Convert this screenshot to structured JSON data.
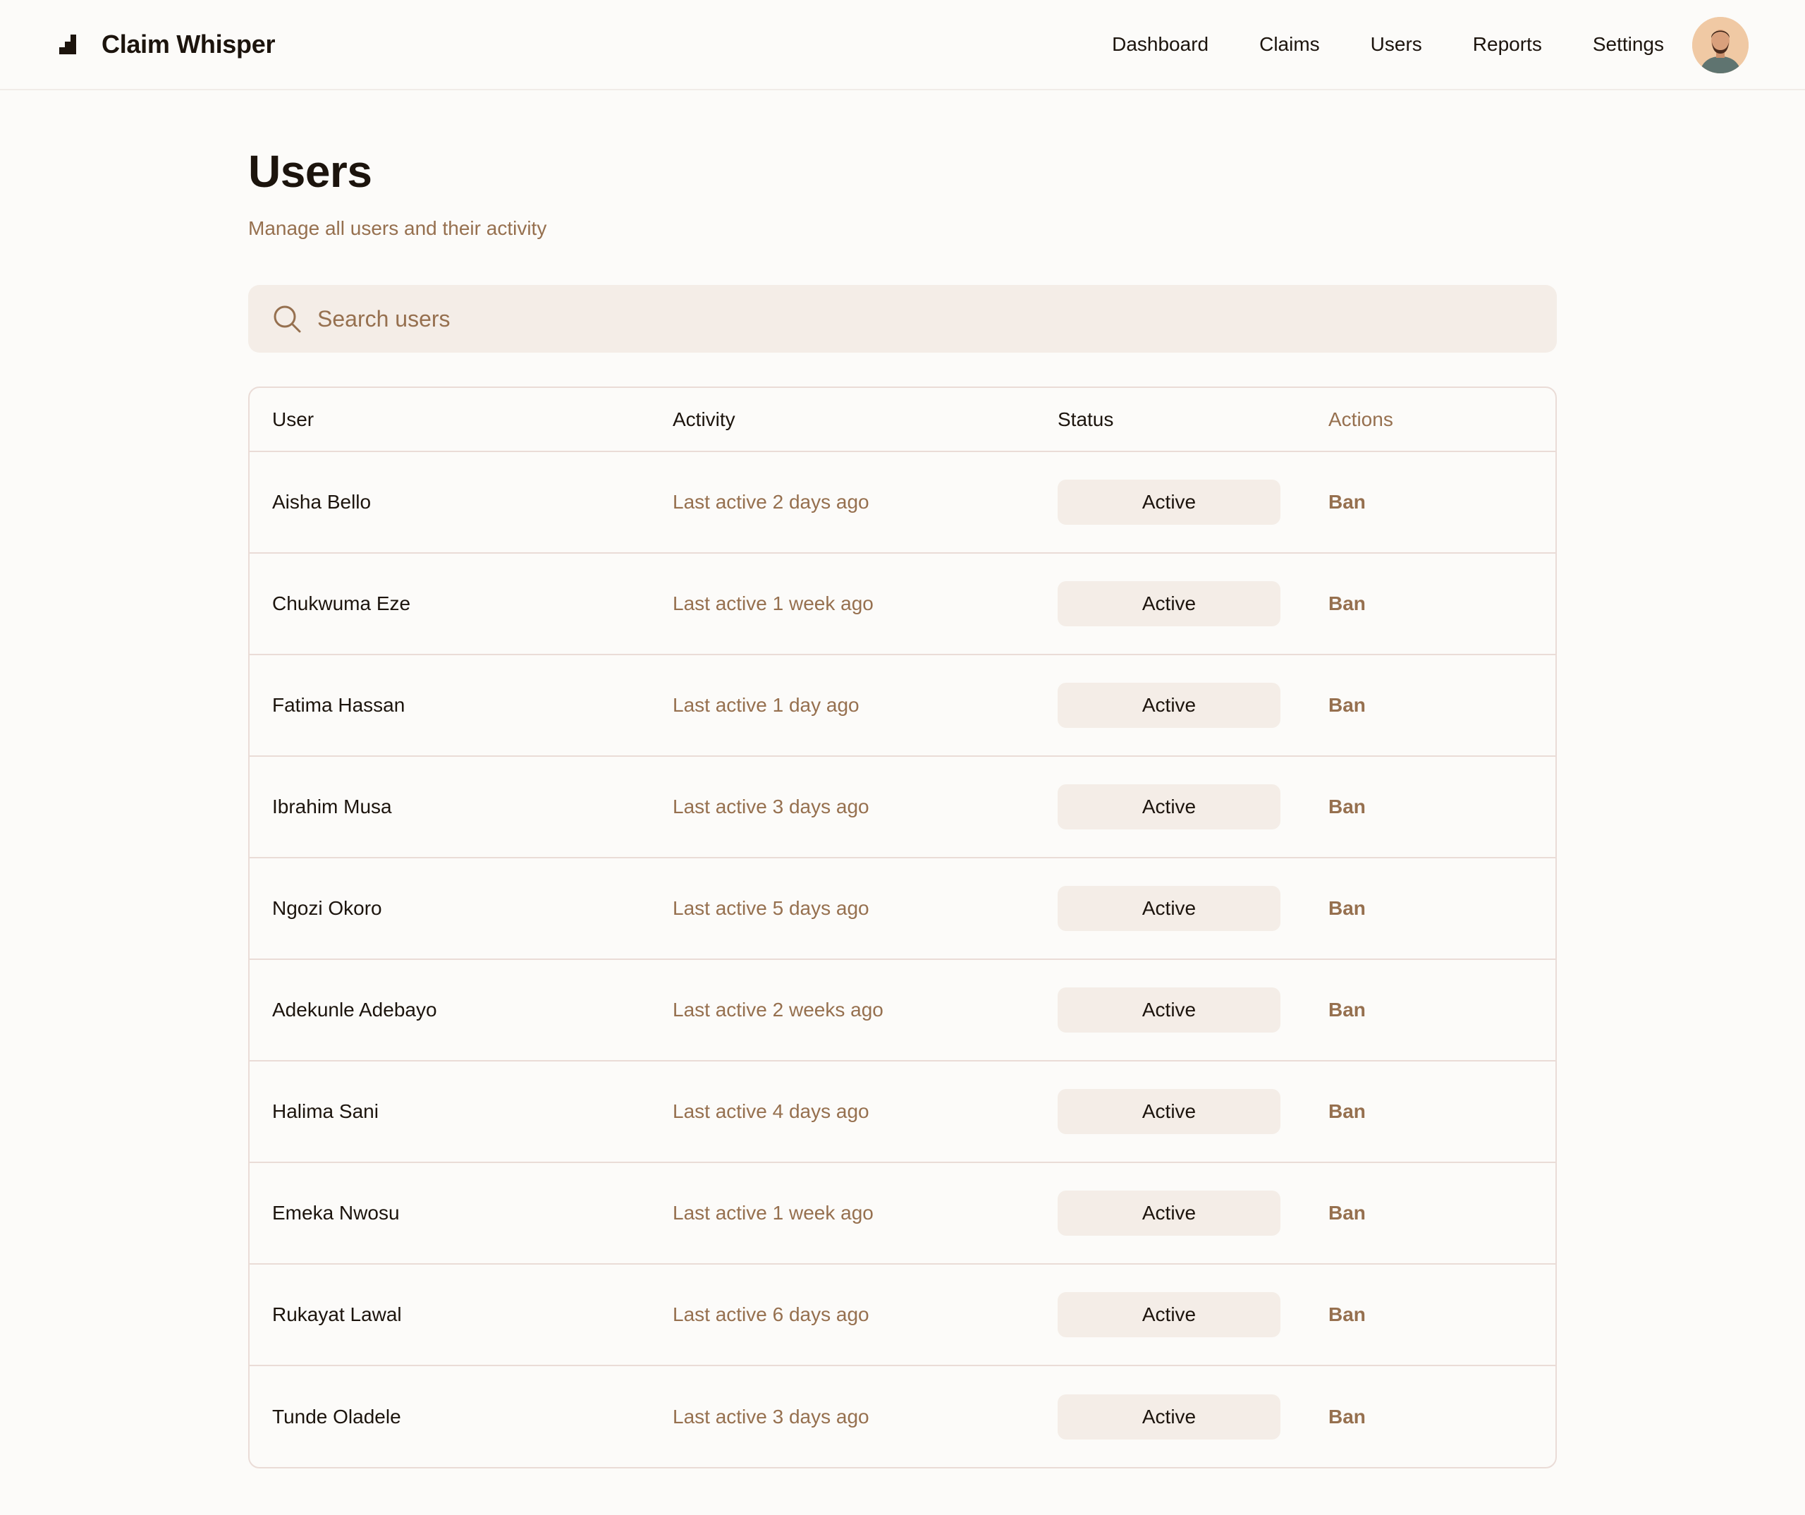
{
  "app": {
    "title": "Claim Whisper"
  },
  "nav": {
    "items": [
      {
        "label": "Dashboard"
      },
      {
        "label": "Claims"
      },
      {
        "label": "Users"
      },
      {
        "label": "Reports"
      },
      {
        "label": "Settings"
      }
    ],
    "avatar_icon": "user-avatar"
  },
  "page": {
    "title": "Users",
    "subtitle": "Manage all users and their activity"
  },
  "search": {
    "placeholder": "Search users",
    "value": "",
    "icon": "search-icon"
  },
  "table": {
    "headers": {
      "user": "User",
      "activity": "Activity",
      "status": "Status",
      "actions": "Actions"
    },
    "rows": [
      {
        "user": "Aisha Bello",
        "activity": "Last active 2 days ago",
        "status": "Active",
        "action": "Ban"
      },
      {
        "user": "Chukwuma Eze",
        "activity": "Last active 1 week ago",
        "status": "Active",
        "action": "Ban"
      },
      {
        "user": "Fatima Hassan",
        "activity": "Last active 1 day ago",
        "status": "Active",
        "action": "Ban"
      },
      {
        "user": "Ibrahim Musa",
        "activity": "Last active 3 days ago",
        "status": "Active",
        "action": "Ban"
      },
      {
        "user": "Ngozi Okoro",
        "activity": "Last active 5 days ago",
        "status": "Active",
        "action": "Ban"
      },
      {
        "user": "Adekunle Adebayo",
        "activity": "Last active 2 weeks ago",
        "status": "Active",
        "action": "Ban"
      },
      {
        "user": "Halima Sani",
        "activity": "Last active 4 days ago",
        "status": "Active",
        "action": "Ban"
      },
      {
        "user": "Emeka Nwosu",
        "activity": "Last active 1 week ago",
        "status": "Active",
        "action": "Ban"
      },
      {
        "user": "Rukayat Lawal",
        "activity": "Last active 6 days ago",
        "status": "Active",
        "action": "Ban"
      },
      {
        "user": "Tunde Oladele",
        "activity": "Last active 3 days ago",
        "status": "Active",
        "action": "Ban"
      }
    ]
  },
  "colors": {
    "background": "#fcfbf9",
    "text_primary": "#1c140d",
    "text_muted": "#96704f",
    "pill_bg": "#f4ede7",
    "border": "#eadcd7"
  }
}
